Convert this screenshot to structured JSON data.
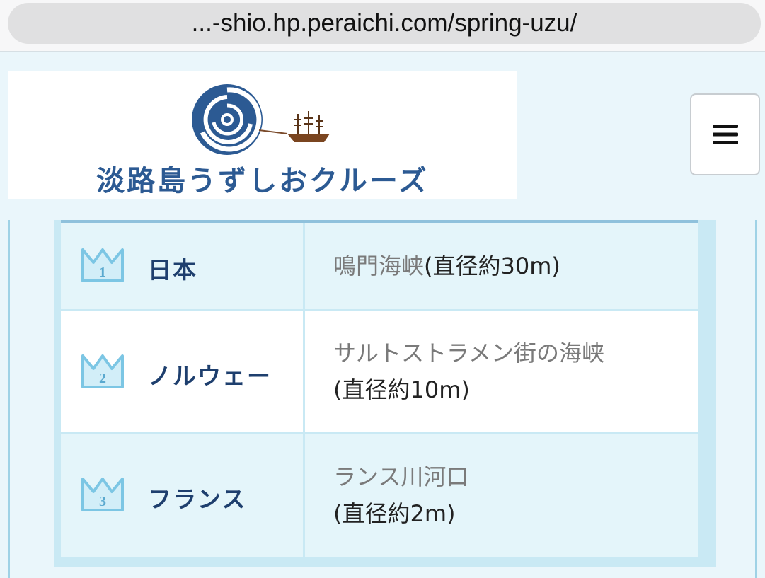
{
  "browser": {
    "url": "...-shio.hp.peraichi.com/spring-uzu/"
  },
  "header": {
    "logo_text": "淡路島うずしおクルーズ",
    "logo_icon": "whirlpool-ship-logo",
    "menu_icon": "hamburger-menu-icon"
  },
  "colors": {
    "brand": "#2c5a93",
    "table_accent": "#c9e9f4",
    "crown": "#7cc6e4"
  },
  "ranking": [
    {
      "rank": "1",
      "country": "日本",
      "place": "鳴門海峡",
      "size": "(直径約30m)",
      "inline": true
    },
    {
      "rank": "2",
      "country": "ノルウェー",
      "place": "サルトストラメン街の海峡",
      "size": "(直径約10m)",
      "inline": false
    },
    {
      "rank": "3",
      "country": "フランス",
      "place": "ランス川河口",
      "size": "(直径約2m)",
      "inline": false
    }
  ]
}
